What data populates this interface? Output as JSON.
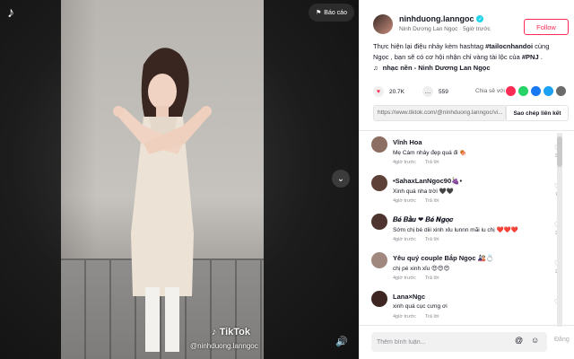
{
  "video": {
    "report_label": "Báo cáo",
    "watermark": "TikTok",
    "watermark_user": "@ninhduong.lanngoc"
  },
  "author": {
    "username": "ninhduong.lanngoc",
    "display_name": "Ninh Dương Lan Ngọc",
    "time": "5giờ trước",
    "follow_label": "Follow"
  },
  "description": {
    "text_pre": "Thực hiện lại điệu nhảy kèm hashtag ",
    "hashtag1": "#tailocnhandoi",
    "text_mid": " cùng Ngọc , bạn sẽ có cơ hội nhận chỉ vàng tài lộc của ",
    "hashtag2": "#PNJ",
    "text_post": " ."
  },
  "music": {
    "label": "nhạc nền - Ninh Dương Lan Ngọc"
  },
  "stats": {
    "likes": "20.7K",
    "comments": "559",
    "share_label": "Chia sẻ với"
  },
  "share_colors": [
    "#fe2c55",
    "#25d366",
    "#1877f2",
    "#1da1f2",
    "#6b6b6b"
  ],
  "link": {
    "url": "https://www.tiktok.com/@ninhduong.lanngoc/vi...",
    "copy_label": "Sao chép liên kết"
  },
  "comments": [
    {
      "name": "Vĩnh Hoa",
      "text": "Mẹ Cám nhảy đẹp quá đi 🍖",
      "time": "4giờ trước",
      "reply": "Trả lời",
      "likes": "95",
      "avatar_color": "#8d6e63"
    },
    {
      "name": "•SahaxLanNgoc90🍇•",
      "text": "Xinh quá nha trời 🖤🖤",
      "time": "4giờ trước",
      "reply": "Trả lời",
      "likes": "71",
      "avatar_color": "#5d4037"
    },
    {
      "name": "𝑩𝒆́ 𝑩𝒂̂̀𝒖 ❤ 𝑩𝒆́ 𝑵𝒈𝒐̣𝒄",
      "text": "Sớm chị bé diii xinh xỉu lunnn mãi iu chị ❤️❤️❤️",
      "time": "4giờ trước",
      "reply": "Trả lời",
      "likes": "36",
      "avatar_color": "#4e342e"
    },
    {
      "name": "Yêu quý couple Bắp Ngọc 🎎💍",
      "text": "chị pé xinh xỉu 😍😍😍",
      "time": "4giờ trước",
      "reply": "Trả lời",
      "likes": "25",
      "avatar_color": "#a1887f"
    },
    {
      "name": "Lana×Ngc",
      "text": "xinh quá cục cưng ơi",
      "time": "4giờ trước",
      "reply": "Trả lời",
      "likes": "7",
      "avatar_color": "#3e2723"
    }
  ],
  "composer": {
    "placeholder": "Thêm bình luận...",
    "post_label": "Đăng"
  }
}
